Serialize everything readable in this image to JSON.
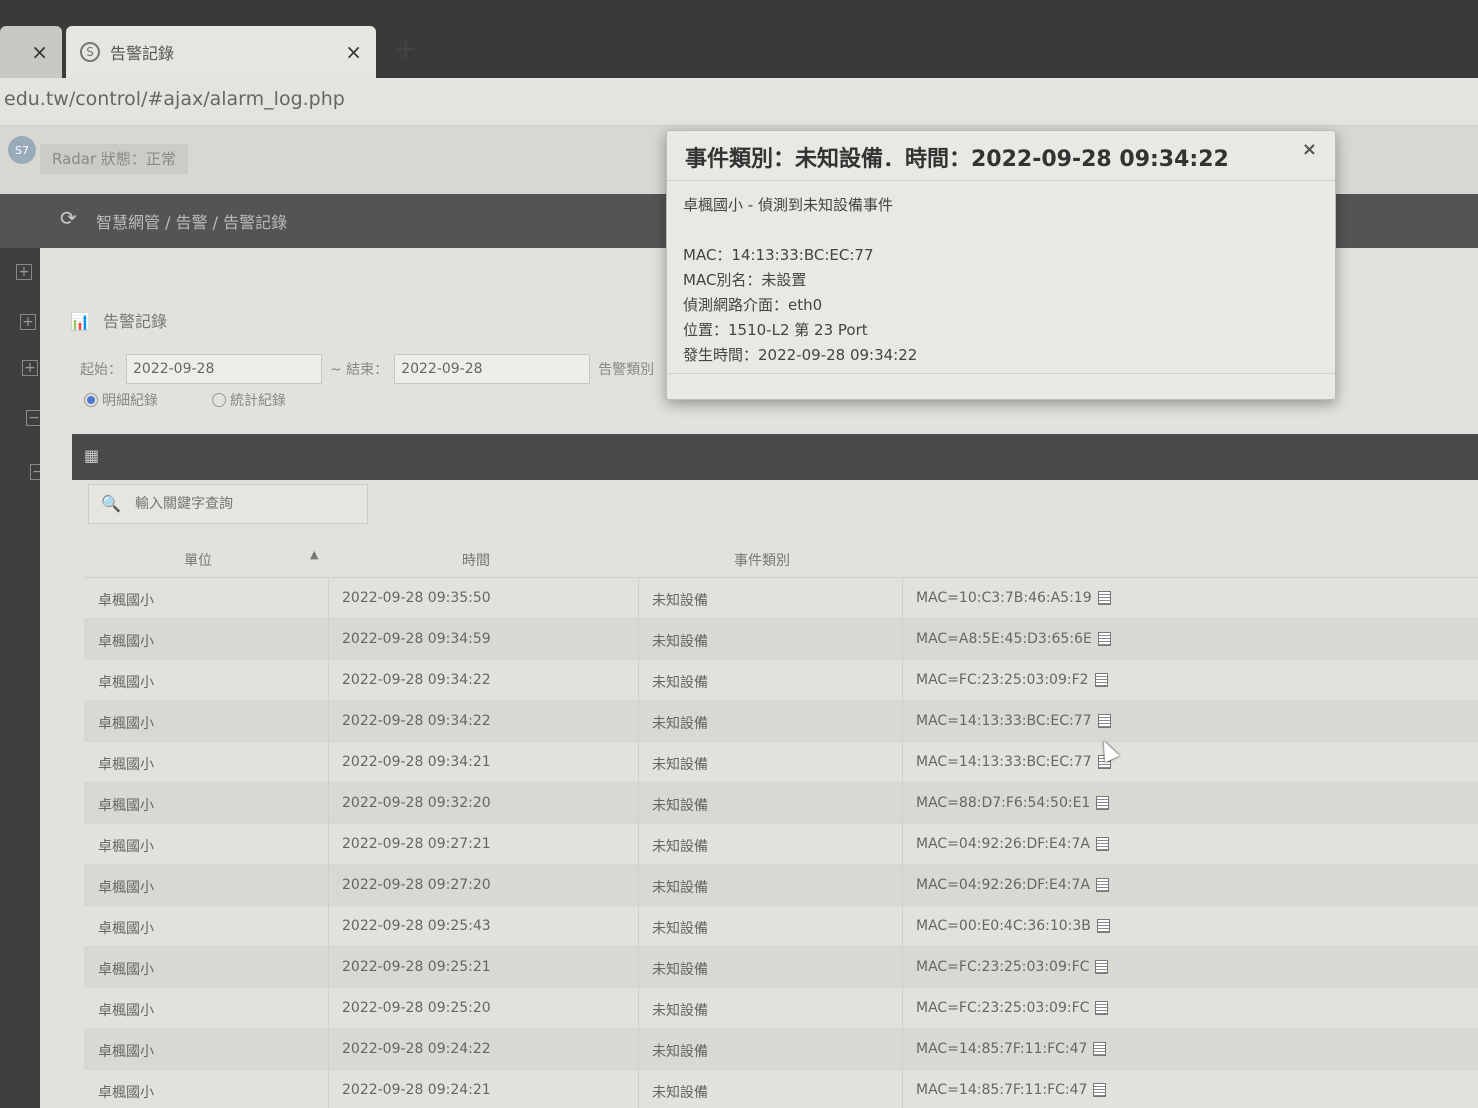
{
  "browser": {
    "tabs": [
      {
        "title": "",
        "close": "×"
      },
      {
        "title": "告警記錄",
        "favicon": "S",
        "close": "×"
      }
    ],
    "new_tab": "+",
    "url": "edu.tw/control/#ajax/alarm_log.php"
  },
  "app": {
    "logo": "S7",
    "status": "Radar 狀態：正常",
    "breadcrumb": "智慧網管 / 告警 / 告警記錄"
  },
  "section": {
    "title": "告警記錄",
    "filter": {
      "start_label": "起始：",
      "start_value": "2022-09-28",
      "end_label": "~ 結束：",
      "end_value": "2022-09-28",
      "type_label": "告警類別"
    },
    "radios": [
      {
        "label": "明細紀錄",
        "checked": true
      },
      {
        "label": "統計紀錄",
        "checked": false
      }
    ],
    "search_placeholder": "輸入關鍵字查詢"
  },
  "table": {
    "columns": [
      "單位",
      "時間",
      "事件類別",
      ""
    ],
    "rows": [
      {
        "unit": "卓楓國小",
        "time": "2022-09-28 09:35:50",
        "type": "未知設備",
        "detail": "MAC=10:C3:7B:46:A5:19"
      },
      {
        "unit": "卓楓國小",
        "time": "2022-09-28 09:34:59",
        "type": "未知設備",
        "detail": "MAC=A8:5E:45:D3:65:6E"
      },
      {
        "unit": "卓楓國小",
        "time": "2022-09-28 09:34:22",
        "type": "未知設備",
        "detail": "MAC=FC:23:25:03:09:F2"
      },
      {
        "unit": "卓楓國小",
        "time": "2022-09-28 09:34:22",
        "type": "未知設備",
        "detail": "MAC=14:13:33:BC:EC:77"
      },
      {
        "unit": "卓楓國小",
        "time": "2022-09-28 09:34:21",
        "type": "未知設備",
        "detail": "MAC=14:13:33:BC:EC:77"
      },
      {
        "unit": "卓楓國小",
        "time": "2022-09-28 09:32:20",
        "type": "未知設備",
        "detail": "MAC=88:D7:F6:54:50:E1"
      },
      {
        "unit": "卓楓國小",
        "time": "2022-09-28 09:27:21",
        "type": "未知設備",
        "detail": "MAC=04:92:26:DF:E4:7A"
      },
      {
        "unit": "卓楓國小",
        "time": "2022-09-28 09:27:20",
        "type": "未知設備",
        "detail": "MAC=04:92:26:DF:E4:7A"
      },
      {
        "unit": "卓楓國小",
        "time": "2022-09-28 09:25:43",
        "type": "未知設備",
        "detail": "MAC=00:E0:4C:36:10:3B"
      },
      {
        "unit": "卓楓國小",
        "time": "2022-09-28 09:25:21",
        "type": "未知設備",
        "detail": "MAC=FC:23:25:03:09:FC"
      },
      {
        "unit": "卓楓國小",
        "time": "2022-09-28 09:25:20",
        "type": "未知設備",
        "detail": "MAC=FC:23:25:03:09:FC"
      },
      {
        "unit": "卓楓國小",
        "time": "2022-09-28 09:24:22",
        "type": "未知設備",
        "detail": "MAC=14:85:7F:11:FC:47"
      },
      {
        "unit": "卓楓國小",
        "time": "2022-09-28 09:24:21",
        "type": "未知設備",
        "detail": "MAC=14:85:7F:11:FC:47"
      }
    ]
  },
  "modal": {
    "title": "事件類別：未知設備．時間：2022-09-28 09:34:22",
    "close": "×",
    "summary": "卓楓國小 - 偵測到未知設備事件",
    "lines": [
      "MAC：14:13:33:BC:EC:77",
      "MAC別名：未設置",
      "偵測網路介面：eth0",
      "位置：1510-L2 第 23 Port",
      "發生時間：2022-09-28 09:34:22"
    ]
  }
}
